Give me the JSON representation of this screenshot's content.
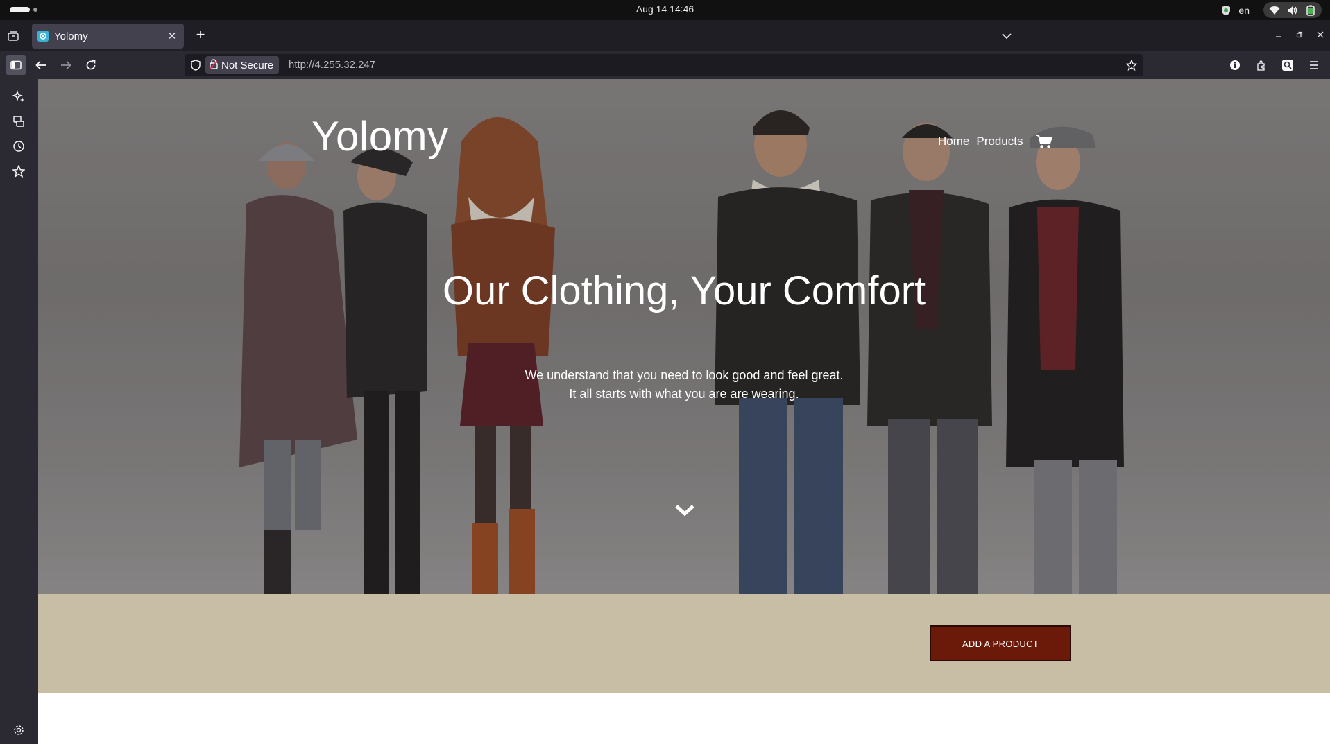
{
  "os": {
    "clock": "Aug 14  14:46",
    "language": "en"
  },
  "browser": {
    "tab_title": "Yolomy",
    "security_label": "Not Secure",
    "url": "http://4.255.32.247"
  },
  "site": {
    "brand": "Yolomy",
    "nav": [
      "Home",
      "Products"
    ],
    "hero_title": "Our Clothing, Your Comfort",
    "hero_subtitle_line1": "We understand that you need to look good and feel great.",
    "hero_subtitle_line2": "It all starts with what you are are wearing.",
    "add_product_label": "ADD A PRODUCT"
  },
  "colors": {
    "band": "#c7bea5",
    "add_button": "#6b1a0a",
    "browser_chrome": "#2b2a33"
  },
  "icons": [
    "overview-icon",
    "favicon-icon",
    "close-icon",
    "plus-icon",
    "chevron-down-icon",
    "minimize-icon",
    "maximize-icon",
    "window-close-icon",
    "sidebar-icon",
    "back-icon",
    "forward-icon",
    "reload-icon",
    "shield-icon",
    "lock-icon",
    "star-icon",
    "info-icon",
    "extensions-icon",
    "zoom-icon",
    "menu-icon",
    "ai-chat-icon",
    "synced-tabs-icon",
    "history-icon",
    "bookmarks-icon",
    "settings-icon",
    "cart-icon",
    "scroll-down-icon"
  ]
}
